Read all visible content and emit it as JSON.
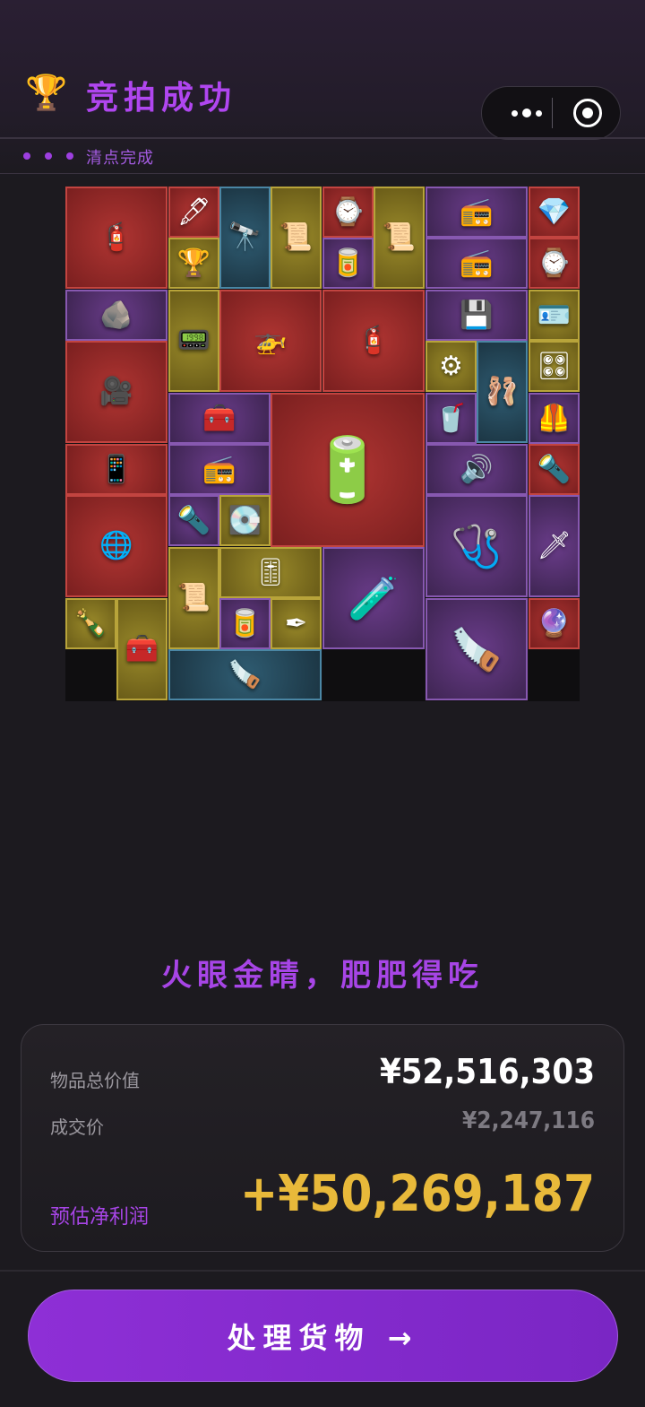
{
  "header": {
    "title": "竞拍成功",
    "trophy_icon": "🏆",
    "status_text": "清点完成"
  },
  "grid_items": [
    {
      "icon": "gas-canister",
      "glyph": "🧯"
    },
    {
      "icon": "pen",
      "glyph": "🖋"
    },
    {
      "icon": "telescope",
      "glyph": "🔭"
    },
    {
      "icon": "map",
      "glyph": "📜"
    },
    {
      "icon": "watch",
      "glyph": "⌚"
    },
    {
      "icon": "map",
      "glyph": "📜"
    },
    {
      "icon": "radio",
      "glyph": "📻"
    },
    {
      "icon": "diamond",
      "glyph": "💎"
    },
    {
      "icon": "trophy-cup",
      "glyph": "🏆"
    },
    {
      "icon": "snack",
      "glyph": "🥫"
    },
    {
      "icon": "radio",
      "glyph": "📻"
    },
    {
      "icon": "bracelet",
      "glyph": "⌚"
    },
    {
      "icon": "stone",
      "glyph": "🪨"
    },
    {
      "icon": "walkie-talkie",
      "glyph": "📟"
    },
    {
      "icon": "drone",
      "glyph": "🚁"
    },
    {
      "icon": "gas-canister",
      "glyph": "🧯"
    },
    {
      "icon": "circuit-board",
      "glyph": "💾"
    },
    {
      "icon": "id-card",
      "glyph": "🪪"
    },
    {
      "icon": "camcorder",
      "glyph": "🎥"
    },
    {
      "icon": "filter",
      "glyph": "⚙"
    },
    {
      "icon": "dancer-statue",
      "glyph": "🩰"
    },
    {
      "icon": "controller",
      "glyph": "🎛"
    },
    {
      "icon": "toolbox",
      "glyph": "🧰"
    },
    {
      "icon": "reactor-core",
      "glyph": "🔋"
    },
    {
      "icon": "can",
      "glyph": "🥤"
    },
    {
      "icon": "vest",
      "glyph": "🦺"
    },
    {
      "icon": "tablet",
      "glyph": "📱"
    },
    {
      "icon": "radio",
      "glyph": "📻"
    },
    {
      "icon": "speaker",
      "glyph": "🔊"
    },
    {
      "icon": "flashlight",
      "glyph": "🔦"
    },
    {
      "icon": "armillary-sphere",
      "glyph": "🌐"
    },
    {
      "icon": "flashlight",
      "glyph": "🔦"
    },
    {
      "icon": "hard-drive",
      "glyph": "💽"
    },
    {
      "icon": "blood-pressure-monitor",
      "glyph": "🩺"
    },
    {
      "icon": "dagger",
      "glyph": "🗡"
    },
    {
      "icon": "map",
      "glyph": "📜"
    },
    {
      "icon": "control-panel",
      "glyph": "🎚"
    },
    {
      "icon": "centrifuge",
      "glyph": "🧪"
    },
    {
      "icon": "liquor",
      "glyph": "🍾"
    },
    {
      "icon": "tool-case",
      "glyph": "🧰"
    },
    {
      "icon": "snack",
      "glyph": "🥫"
    },
    {
      "icon": "pens",
      "glyph": "✒"
    },
    {
      "icon": "circular-saw",
      "glyph": "🪚"
    },
    {
      "icon": "orb",
      "glyph": "🔮"
    },
    {
      "icon": "saw",
      "glyph": "🪚"
    }
  ],
  "slogan": "火眼金睛，肥肥得吃",
  "summary": {
    "total_label": "物品总价值",
    "total_value": "¥52,516,303",
    "deal_label": "成交价",
    "deal_value": "¥2,247,116",
    "profit_label": "预估净利润",
    "profit_value": "+¥50,269,187"
  },
  "action": {
    "button_label": "处理货物 →"
  },
  "colors": {
    "accent_purple": "#a745e6",
    "profit_gold": "#e8b93a",
    "rarity_red": "#c24440",
    "rarity_gold": "#b8a43a",
    "rarity_purple": "#8758b0",
    "rarity_blue": "#4a86a4"
  }
}
